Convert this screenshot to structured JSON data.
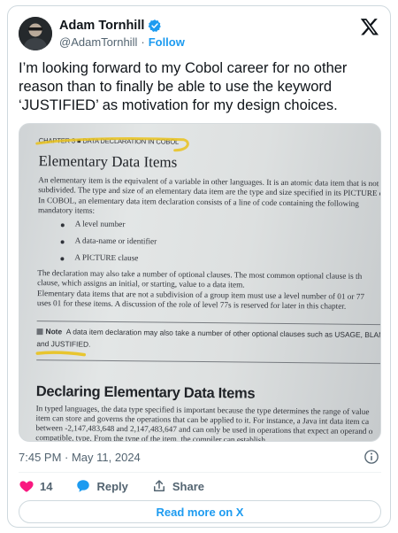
{
  "author": {
    "name": "Adam Tornhill",
    "handle": "@AdamTornhill",
    "separator": "·",
    "follow_label": "Follow"
  },
  "tweet": {
    "text": "I’m looking forward to my Cobol career for no other reason than to finally be able to use the keyword ‘JUSTIFIED’ as motivation for my design choices."
  },
  "photo": {
    "chapter": "CHAPTER 3 ■ DATA DECLARATION IN COBOL",
    "heading": "Elementary Data Items",
    "para1": [
      "An elementary item is the equivalent of a variable in other languages. It is an atomic data item that is not fu",
      "subdivided. The type and size of an elementary data item are the type and size specified in its PICTURE cla",
      "   In COBOL, an elementary data item declaration consists of a line of code containing the following",
      "mandatory items:"
    ],
    "bullets": [
      "A level number",
      "A data-name or identifier",
      "A PICTURE clause"
    ],
    "para2": [
      "   The declaration may also take a number of optional clauses. The most common optional clause is th",
      "clause, which assigns an initial, or starting, value to a data item.",
      "   Elementary data items that are not a subdivision of a group item must use a level number of 01 or 77",
      "uses 01 for these items. A discussion of the role of level 77s is reserved for later in this chapter."
    ],
    "note_label": "Note",
    "note_line1": "A data item declaration may also take a number of other optional clauses such as USAGE, BLANK",
    "note_line2": "and JUSTIFIED.",
    "heading2": "Declaring Elementary Data Items",
    "para3": [
      "In typed languages, the data type specified is important because the type determines the range of value",
      "item can store and governs the operations that can be applied to it. For instance, a Java int data item ca",
      "between -2,147,483,648 and 2,147,483,647 and can only be used in operations that expect an operand o",
      "compatible, type. From the type of the item, the compiler can establish"
    ]
  },
  "meta": {
    "timestamp": "7:45 PM · May 11, 2024"
  },
  "actions": {
    "likes": "14",
    "reply_label": "Reply",
    "share_label": "Share"
  },
  "read_more_label": "Read more on X",
  "colors": {
    "accent": "#1d9bf0",
    "like": "#f91880",
    "text_secondary": "#536471",
    "highlight": "#e9c21c"
  },
  "icons": [
    "verified-badge-icon",
    "x-logo-icon",
    "info-icon",
    "heart-icon",
    "reply-icon",
    "share-icon"
  ]
}
